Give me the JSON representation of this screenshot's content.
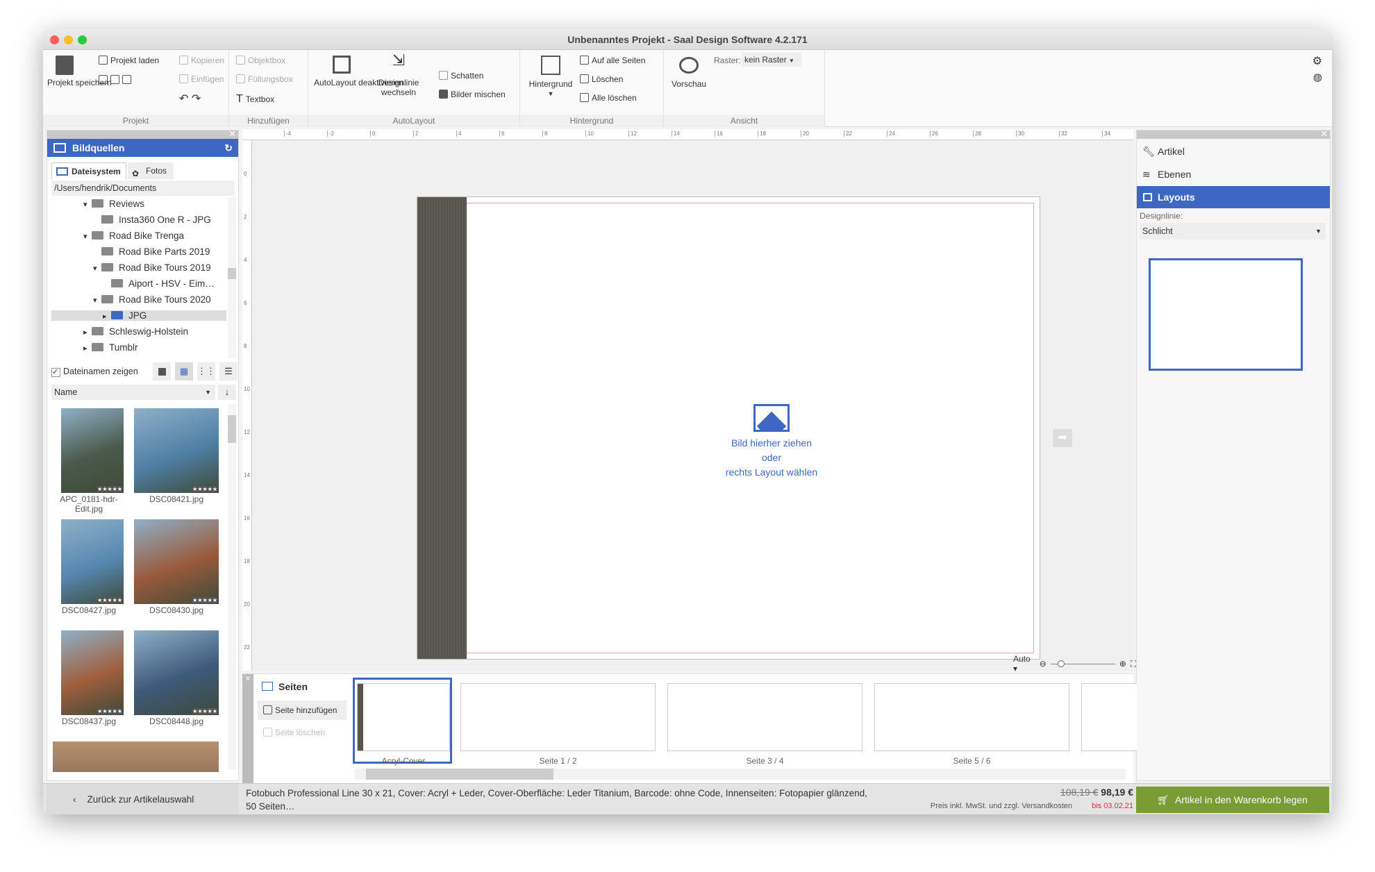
{
  "window": {
    "title": "Unbenanntes Projekt - Saal Design Software 4.2.171"
  },
  "ribbon": {
    "projekt": {
      "label": "Projekt",
      "save": "Projekt speichern",
      "load": "Projekt laden",
      "copy": "Kopieren",
      "paste": "Einfügen"
    },
    "hinzufuegen": {
      "label": "Hinzufügen",
      "objektbox": "Objektbox",
      "fuellungsbox": "Füllungsbox",
      "textbox": "Textbox"
    },
    "autolayout": {
      "label": "AutoLayout",
      "deactivate": "AutoLayout deaktivieren",
      "designline": "Designlinie wechseln",
      "shadow": "Schatten",
      "mix": "Bilder mischen"
    },
    "hintergrund": {
      "label": "Hintergrund",
      "background": "Hintergrund",
      "all_pages": "Auf alle Seiten",
      "delete": "Löschen",
      "delete_all": "Alle löschen"
    },
    "ansicht": {
      "label": "Ansicht",
      "preview": "Vorschau",
      "raster_label": "Raster:",
      "raster_value": "kein Raster"
    }
  },
  "left": {
    "title": "Bildquellen",
    "tabs": [
      "Dateisystem",
      "Fotos"
    ],
    "path": "/Users/hendrik/Documents",
    "tree": [
      {
        "label": "Reviews",
        "level": 0,
        "expanded": true
      },
      {
        "label": "Insta360 One R - JPG",
        "level": 1
      },
      {
        "label": "Road Bike Trenga",
        "level": 0,
        "expanded": true
      },
      {
        "label": "Road  Bike Parts 2019",
        "level": 1
      },
      {
        "label": "Road Bike Tours 2019",
        "level": 1,
        "expanded": true
      },
      {
        "label": "Aiport - HSV - Eim…",
        "level": 2
      },
      {
        "label": "Road Bike Tours 2020",
        "level": 1,
        "expanded": true
      },
      {
        "label": "JPG",
        "level": 2,
        "selected": true
      },
      {
        "label": "Schleswig-Holstein",
        "level": 0
      },
      {
        "label": "Tumblr",
        "level": 0
      }
    ],
    "show_names": "Dateinamen zeigen",
    "show_names_checked": true,
    "sort": "Name",
    "photos": [
      {
        "name": "APC_0181-hdr-Edit.jpg",
        "color": "#4a5a4a"
      },
      {
        "name": "DSC08421.jpg",
        "color": "#4f7fa5"
      },
      {
        "name": "DSC08427.jpg",
        "color": "#5687b0"
      },
      {
        "name": "DSC08430.jpg",
        "color": "#9a5a3c"
      },
      {
        "name": "DSC08437.jpg",
        "color": "#a05e3c"
      },
      {
        "name": "DSC08448.jpg",
        "color": "#3d5a7a"
      }
    ],
    "back": "Zurück zur Artikelauswahl"
  },
  "canvas": {
    "drop_line1": "Bild hierher ziehen",
    "drop_line2": "oder",
    "drop_line3": "rechts Layout wählen",
    "zoom": "Auto",
    "ruler": [
      "-4",
      "-2",
      "0",
      "2",
      "4",
      "6",
      "8",
      "10",
      "12",
      "14",
      "16",
      "18",
      "20",
      "22",
      "24",
      "26",
      "28",
      "30",
      "32",
      "34"
    ],
    "vruler": [
      "0",
      "2",
      "4",
      "6",
      "8",
      "10",
      "12",
      "14",
      "16",
      "18",
      "20",
      "22"
    ]
  },
  "right": {
    "items": [
      "Artikel",
      "Ebenen",
      "Layouts"
    ],
    "active": "Layouts",
    "designline_label": "Designlinie:",
    "designline_value": "Schlicht"
  },
  "pages": {
    "title": "Seiten",
    "add": "Seite hinzufügen",
    "delete": "Seite löschen",
    "thumbs": [
      "Acryl-Cover",
      "Seite 1 / 2",
      "Seite 3 / 4",
      "Seite 5 / 6"
    ]
  },
  "bottom": {
    "description": "Fotobuch Professional Line 30 x 21, Cover: Acryl + Leder, Cover-Oberfläche: Leder Titanium, Barcode: ohne Code, Innenseiten: Fotopapier glänzend, 50 Seiten…",
    "old_price": "108,19 €",
    "price": "98,19 €",
    "price_note": "Preis inkl. MwSt. und zzgl. Versandkosten",
    "valid": "bis 03.02.21",
    "cart": "Artikel in den Warenkorb legen"
  },
  "colors": {
    "accent": "#3d67c3",
    "cart": "#7a9c35",
    "valid": "#d0343a"
  }
}
